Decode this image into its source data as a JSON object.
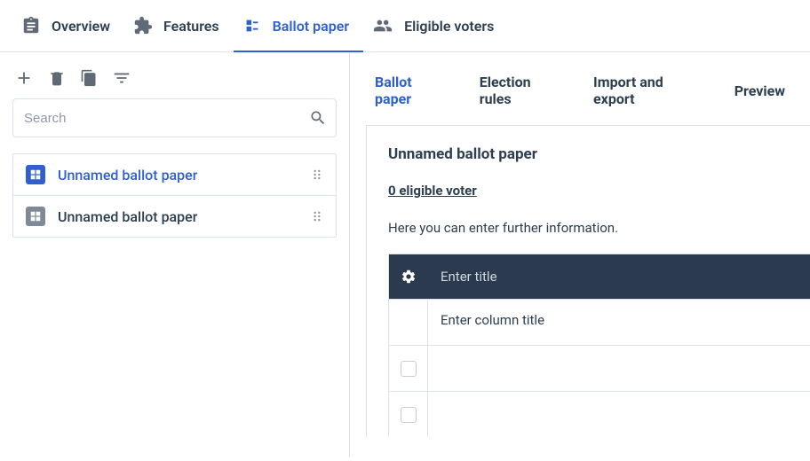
{
  "topTabs": [
    {
      "id": "overview",
      "label": "Overview",
      "active": false
    },
    {
      "id": "features",
      "label": "Features",
      "active": false
    },
    {
      "id": "ballot-paper",
      "label": "Ballot paper",
      "active": true
    },
    {
      "id": "eligible-voters",
      "label": "Eligible voters",
      "active": false
    }
  ],
  "sidebar": {
    "searchPlaceholder": "Search",
    "items": [
      {
        "label": "Unnamed ballot paper",
        "active": true
      },
      {
        "label": "Unnamed ballot paper",
        "active": false
      }
    ]
  },
  "subTabs": [
    {
      "id": "ballot-paper",
      "label": "Ballot paper",
      "active": true
    },
    {
      "id": "election-rules",
      "label": "Election rules",
      "active": false
    },
    {
      "id": "import-export",
      "label": "Import and export",
      "active": false
    },
    {
      "id": "preview",
      "label": "Preview",
      "active": false
    }
  ],
  "detail": {
    "title": "Unnamed ballot paper",
    "eligibleVoters": "0 eligible voter",
    "infoText": "Here you can enter further information.",
    "tableTitlePlaceholder": "Enter title",
    "columnTitlePlaceholder": "Enter column title"
  }
}
